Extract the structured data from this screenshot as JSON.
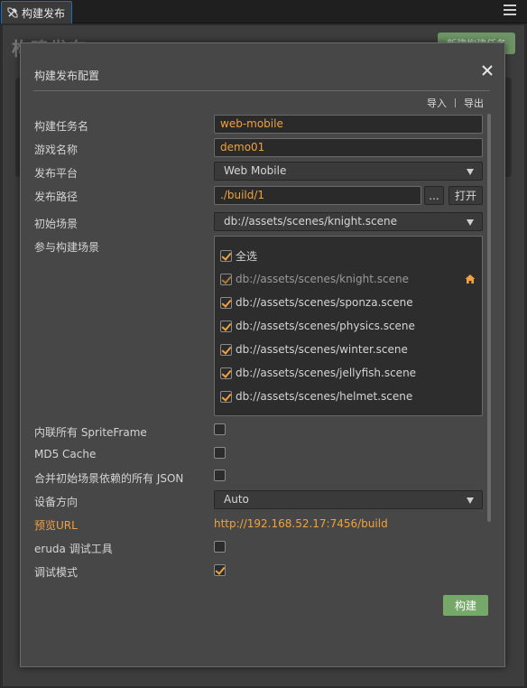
{
  "tab": {
    "title": "构建发布"
  },
  "background": {
    "title": "构建发布",
    "button": "新建构建任务"
  },
  "dialog": {
    "title": "构建发布配置",
    "import_label": "导入",
    "export_label": "导出",
    "fields": {
      "task_name": {
        "label": "构建任务名",
        "value": "web-mobile"
      },
      "game_name": {
        "label": "游戏名称",
        "value": "demo01"
      },
      "platform": {
        "label": "发布平台",
        "value": "Web Mobile"
      },
      "path": {
        "label": "发布路径",
        "value": "./build/1",
        "browse_label": "...",
        "open_label": "打开"
      },
      "start_scene": {
        "label": "初始场景",
        "value": "db://assets/scenes/knight.scene"
      },
      "scenes": {
        "label": "参与构建场景",
        "select_all": "全选",
        "items": [
          {
            "path": "db://assets/scenes/knight.scene",
            "checked": true,
            "disabled": true,
            "home": true
          },
          {
            "path": "db://assets/scenes/sponza.scene",
            "checked": true
          },
          {
            "path": "db://assets/scenes/physics.scene",
            "checked": true
          },
          {
            "path": "db://assets/scenes/winter.scene",
            "checked": true
          },
          {
            "path": "db://assets/scenes/jellyfish.scene",
            "checked": true
          },
          {
            "path": "db://assets/scenes/helmet.scene",
            "checked": true
          }
        ]
      },
      "inline_spriteframe": {
        "label": "内联所有 SpriteFrame",
        "checked": false
      },
      "md5_cache": {
        "label": "MD5 Cache",
        "checked": false
      },
      "merge_json": {
        "label": "合并初始场景依赖的所有 JSON",
        "checked": false
      },
      "orientation": {
        "label": "设备方向",
        "value": "Auto"
      },
      "preview_url": {
        "label": "预览URL",
        "value": "http://192.168.52.17:7456/build"
      },
      "eruda": {
        "label": "eruda 调试工具",
        "checked": false
      },
      "debug": {
        "label": "调试模式",
        "checked": true
      }
    },
    "build_button": "构建"
  },
  "colors": {
    "accent": "#f0a23c",
    "build_button": "#76a86a",
    "tab_border": "#1b6fb8"
  }
}
